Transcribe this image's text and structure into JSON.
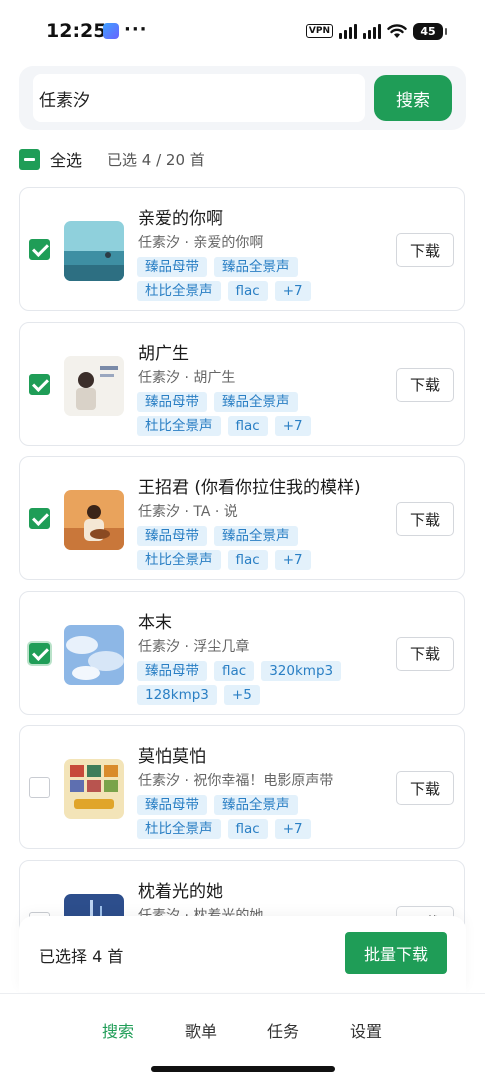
{
  "status_bar": {
    "time": "12:25",
    "more": "···",
    "vpn": "VPN",
    "battery": "45"
  },
  "search": {
    "query": "任素汐",
    "button_label": "搜索"
  },
  "selection": {
    "select_all_label": "全选",
    "selected_summary": "已选 4 / 20 首"
  },
  "songs": [
    {
      "title": "亲爱的你啊",
      "subtitle": "任素汐 · 亲爱的你啊",
      "checked": true,
      "tags": [
        "臻品母带",
        "臻品全景声",
        "杜比全景声",
        "flac",
        "+7"
      ],
      "download_label": "下载"
    },
    {
      "title": "胡广生",
      "subtitle": "任素汐 · 胡广生",
      "checked": true,
      "tags": [
        "臻品母带",
        "臻品全景声",
        "杜比全景声",
        "flac",
        "+7"
      ],
      "download_label": "下载"
    },
    {
      "title": "王招君 (你看你拉住我的模样)",
      "subtitle": "任素汐 · TA · 说",
      "checked": true,
      "tags": [
        "臻品母带",
        "臻品全景声",
        "杜比全景声",
        "flac",
        "+7"
      ],
      "download_label": "下载"
    },
    {
      "title": "本末",
      "subtitle": "任素汐 · 浮尘几章",
      "checked": true,
      "tags": [
        "臻品母带",
        "flac",
        "320kmp3",
        "128kmp3",
        "+5"
      ],
      "download_label": "下载"
    },
    {
      "title": "莫怕莫怕",
      "subtitle": "任素汐 · 祝你幸福！电影原声带",
      "checked": false,
      "tags": [
        "臻品母带",
        "臻品全景声",
        "杜比全景声",
        "flac",
        "+7"
      ],
      "download_label": "下载"
    },
    {
      "title": "枕着光的她",
      "subtitle": "任素汐 · 枕着光的她",
      "checked": false,
      "tags": [],
      "download_label": "下载"
    }
  ],
  "bottom_bar": {
    "selected_text": "已选择 4 首",
    "batch_download_label": "批量下载"
  },
  "tabs": [
    {
      "label": "搜索",
      "active": true
    },
    {
      "label": "歌单",
      "active": false
    },
    {
      "label": "任务",
      "active": false
    },
    {
      "label": "设置",
      "active": false
    }
  ],
  "colors": {
    "accent": "#1f9d57",
    "tag_bg": "#e3f1fb",
    "tag_text": "#2a7fc4"
  }
}
